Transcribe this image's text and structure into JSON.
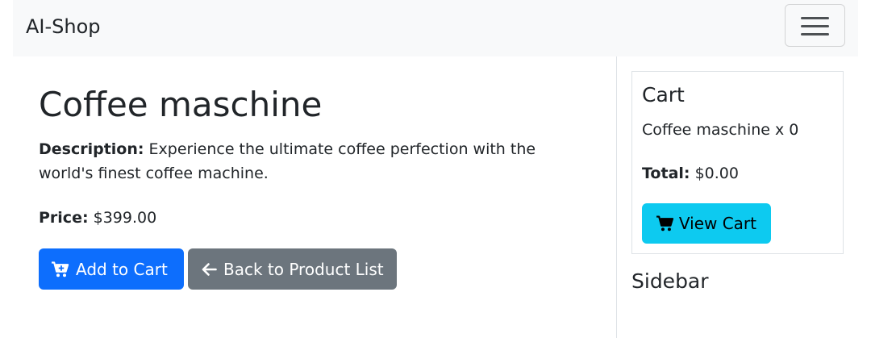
{
  "navbar": {
    "brand": "AI-Shop",
    "toggler_icon": "hamburger-menu-icon"
  },
  "product": {
    "name": "Coffee maschine",
    "description_label": "Description:",
    "description": "Experience the ultimate coffee perfection with the world's finest coffee machine.",
    "price_label": "Price:",
    "price": "$399.00"
  },
  "actions": {
    "add_to_cart": "Add to Cart",
    "add_to_cart_icon": "cart-plus-icon",
    "back_to_list": "Back to Product List",
    "back_icon": "arrow-left-icon"
  },
  "cart": {
    "title": "Cart",
    "items": [
      {
        "name": "Coffee maschine",
        "sep": "x",
        "quantity": 0
      }
    ],
    "total_label": "Total:",
    "total": "$0.00",
    "view_cart": "View Cart",
    "view_cart_icon": "cart-icon"
  },
  "sidebar": {
    "title": "Sidebar"
  },
  "colors": {
    "navbar_bg": "#f8f9fa",
    "primary": "#0d6efd",
    "secondary": "#6c757d",
    "info": "#0dcaf0",
    "text": "#212529"
  }
}
